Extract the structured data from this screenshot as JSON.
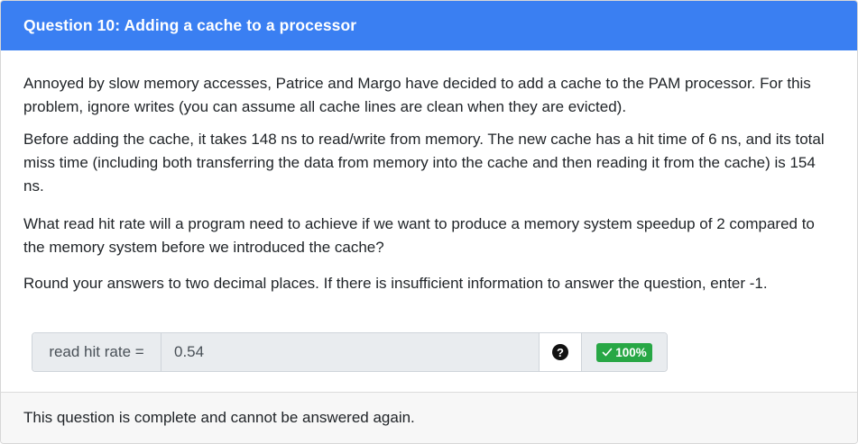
{
  "header": {
    "title": "Question 10: Adding a cache to a processor"
  },
  "body": {
    "paragraphs": [
      "Annoyed by slow memory accesses, Patrice and Margo have decided to add a cache to the PAM processor. For this problem, ignore writes (you can assume all cache lines are clean when they are evicted).",
      "Before adding the cache, it takes 148 ns to read/write from memory. The new cache has a hit time of 6 ns, and its total miss time (including both transferring the data from memory into the cache and then reading it from the cache) is 154 ns.",
      "What read hit rate will a program need to achieve if we want to produce a memory system speedup of 2 compared to the memory system before we introduced the cache?",
      "Round your answers to two decimal places. If there is insufficient information to answer the question, enter -1."
    ]
  },
  "answer": {
    "label": "read hit rate =",
    "value": "0.54",
    "help_icon": "question-circle-icon",
    "help_glyph": "?",
    "badge_icon": "check-icon",
    "badge_text": "100%"
  },
  "footer": {
    "text": "This question is complete and cannot be answered again."
  },
  "colors": {
    "header_bg": "#3a7ff2",
    "badge_bg": "#28a745",
    "footer_bg": "#f7f7f7"
  }
}
